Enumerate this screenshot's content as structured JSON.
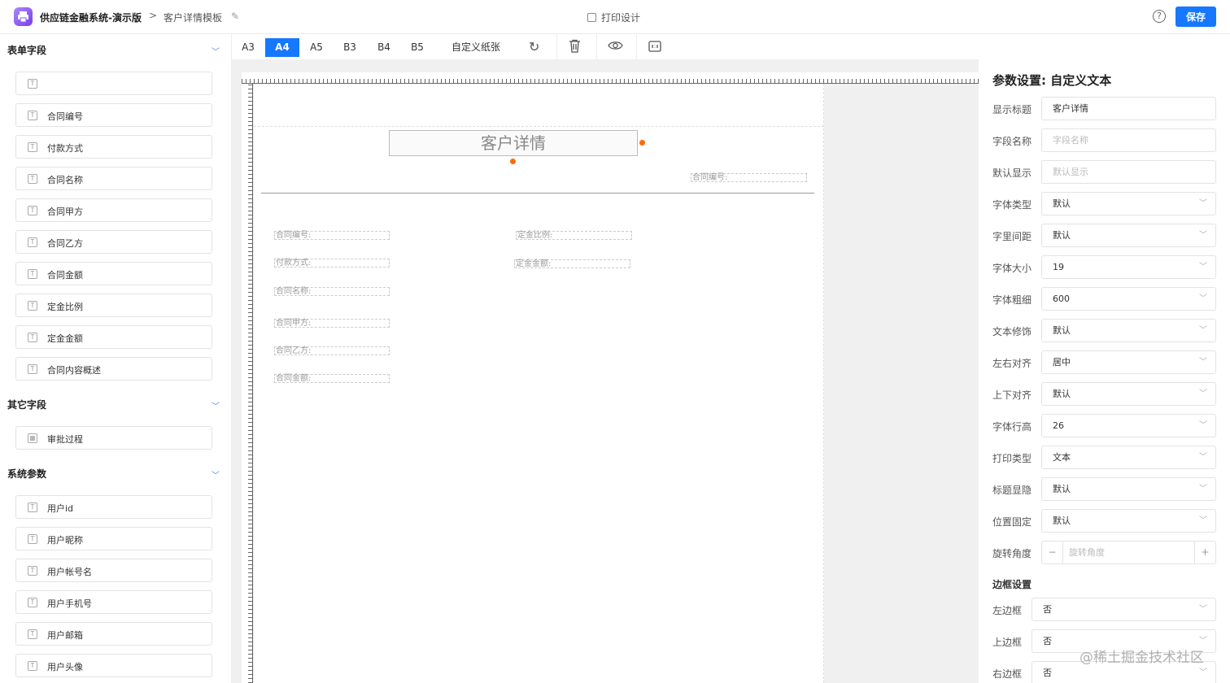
{
  "header": {
    "app_title": "供应链金融系统-演示版",
    "breadcrumb_separator": ">",
    "page_name": "客户详情模板",
    "center_title": "打印设计",
    "help_symbol": "?",
    "save_label": "保存"
  },
  "left": {
    "form_fields_title": "表单字段",
    "form_fields": [
      "",
      "合同编号",
      "付款方式",
      "合同名称",
      "合同甲方",
      "合同乙方",
      "合同金额",
      "定金比例",
      "定金金额",
      "合同内容概述"
    ],
    "other_fields_title": "其它字段",
    "other_fields": [
      "审批过程"
    ],
    "system_params_title": "系统参数",
    "system_params": [
      "用户id",
      "用户昵称",
      "用户帐号名",
      "用户手机号",
      "用户邮箱",
      "用户头像"
    ]
  },
  "toolbar": {
    "papers": [
      "A3",
      "A4",
      "A5",
      "B3",
      "B4",
      "B5",
      "自定义纸张"
    ],
    "active_paper": "A4",
    "icons": [
      "refresh-icon",
      "trash-icon",
      "eye-icon",
      "fit-icon"
    ]
  },
  "canvas": {
    "title_text": "客户详情",
    "header_field": "合同编号:",
    "left_fields": [
      "合同编号:",
      "付款方式:",
      "合同名称:",
      "合同甲方:",
      "合同乙方:",
      "合同金额:"
    ],
    "right_fields": [
      "定金比例:",
      "定金金额:"
    ]
  },
  "props": {
    "title": "参数设置: 自定义文本",
    "display_title_label": "显示标题",
    "display_title_value": "客户详情",
    "field_name_label": "字段名称",
    "field_name_placeholder": "字段名称",
    "default_display_label": "默认显示",
    "default_display_placeholder": "默认显示",
    "font_type_label": "字体类型",
    "font_type_value": "默认",
    "letter_spacing_label": "字里间距",
    "letter_spacing_value": "默认",
    "font_size_label": "字体大小",
    "font_size_value": "19",
    "font_weight_label": "字体粗细",
    "font_weight_value": "600",
    "text_decoration_label": "文本修饰",
    "text_decoration_value": "默认",
    "h_align_label": "左右对齐",
    "h_align_value": "居中",
    "v_align_label": "上下对齐",
    "v_align_value": "默认",
    "line_height_label": "字体行高",
    "line_height_value": "26",
    "print_type_label": "打印类型",
    "print_type_value": "文本",
    "title_visible_label": "标题显隐",
    "title_visible_value": "默认",
    "position_fixed_label": "位置固定",
    "position_fixed_value": "默认",
    "rotation_label": "旋转角度",
    "rotation_placeholder": "旋转角度",
    "stepper_minus": "−",
    "stepper_plus": "+",
    "border_title": "边框设置",
    "left_border_label": "左边框",
    "left_border_value": "否",
    "top_border_label": "上边框",
    "top_border_value": "否",
    "right_border_label": "右边框",
    "right_border_value": "否"
  },
  "watermark": "@稀土掘金技术社区"
}
